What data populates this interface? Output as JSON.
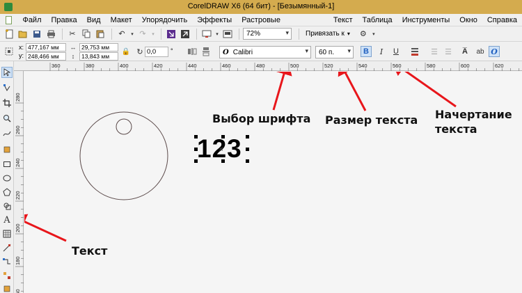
{
  "window": {
    "title": "CorelDRAW X6 (64 бит) - [Безымянный-1]"
  },
  "menu": [
    "Файл",
    "Правка",
    "Вид",
    "Макет",
    "Упорядочить",
    "Эффекты",
    "Растровые изображения",
    "Текст",
    "Таблица",
    "Инструменты",
    "Окно",
    "Справка"
  ],
  "toolbar": {
    "zoom": "72%",
    "snap_label": "Привязать к"
  },
  "propbar": {
    "x_label": "x:",
    "x_value": "477,167 мм",
    "y_label": "y:",
    "y_value": "248,466 мм",
    "w_value": "29,753 мм",
    "h_value": "13,843 мм",
    "angle_value": "0,0",
    "angle_unit": "°",
    "font_family": "Calibri",
    "font_size": "60 п."
  },
  "ruler_h": [
    "360",
    "380",
    "400",
    "420",
    "440",
    "460",
    "480",
    "500",
    "520",
    "540",
    "560",
    "580",
    "600",
    "620",
    "640",
    "660"
  ],
  "ruler_v": [
    "280",
    "260",
    "240",
    "220",
    "200",
    "180",
    "160"
  ],
  "canvas": {
    "text_object": "123"
  },
  "annotations": {
    "font_choice": "Выбор шрифта",
    "text_size": "Размер текста",
    "text_style_line1": "Начертание",
    "text_style_line2": "текста",
    "text_tool": "Текст"
  },
  "colors": {
    "titlebar": "#d4ab4e",
    "arrow": "#e8161b",
    "active_button": "#cfe2f7"
  }
}
